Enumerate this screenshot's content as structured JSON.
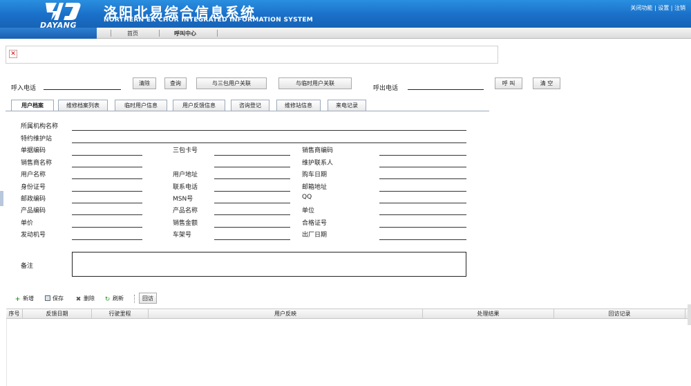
{
  "header": {
    "logo_text": "DAYANG",
    "title_zh": "洛阳北易综合信息系统",
    "title_en": "NORTHERN EK CHOR INTEGRATED INFORMATION SYSTEM",
    "top_links": [
      "关闭功能",
      "设置",
      "注销"
    ],
    "top_link_sep": "|"
  },
  "nav": {
    "items": [
      {
        "label": "首页"
      },
      {
        "label": "呼叫中心"
      }
    ]
  },
  "panel": {
    "close_glyph": "✕"
  },
  "phone": {
    "incoming_label": "呼入电话",
    "incoming_value": "",
    "clear_button": "清除",
    "query_button": "查询",
    "link_sanbao_button": "与三包用户关联",
    "link_temp_button": "与临时用户关联",
    "outgoing_label": "呼出电话",
    "outgoing_value": "",
    "call_button": "呼 叫",
    "clear_all_button": "清 空"
  },
  "tabs": [
    {
      "label": "用户档案",
      "active": true
    },
    {
      "label": "维修档案列表",
      "active": false
    },
    {
      "label": "临时用户信息",
      "active": false
    },
    {
      "label": "用户反馈信息",
      "active": false
    },
    {
      "label": "咨询登记",
      "active": false
    },
    {
      "label": "维修站信息",
      "active": false
    },
    {
      "label": "来电记录",
      "active": false
    }
  ],
  "form": {
    "org_name": "所属机构名称",
    "station": "特约维护站",
    "col1": [
      "单据编码",
      "销售商名称",
      "用户名称",
      "身份证号",
      "邮政编码",
      "产品编码",
      "单价",
      "发动机号"
    ],
    "col2": [
      "三包卡号",
      "",
      "用户地址",
      "联系电话",
      "MSN号",
      "产品名称",
      "销售金额",
      "车架号"
    ],
    "col3": [
      "销售商编码",
      "维护联系人",
      "购车日期",
      "邮箱地址",
      "QQ",
      "单位",
      "合格证号",
      "出厂日期"
    ],
    "remark": "备注"
  },
  "toolbar": {
    "add": "新增",
    "save": "保存",
    "delete": "删除",
    "refresh": "刷新",
    "callback": "回访"
  },
  "grid": {
    "columns": [
      "序号",
      "反馈日期",
      "行驶里程",
      "用户反映",
      "处理结果",
      "回访记录"
    ],
    "rows": []
  },
  "colors": {
    "header_blue": "#1a6fc8",
    "tab_border": "#9aa8b8"
  }
}
